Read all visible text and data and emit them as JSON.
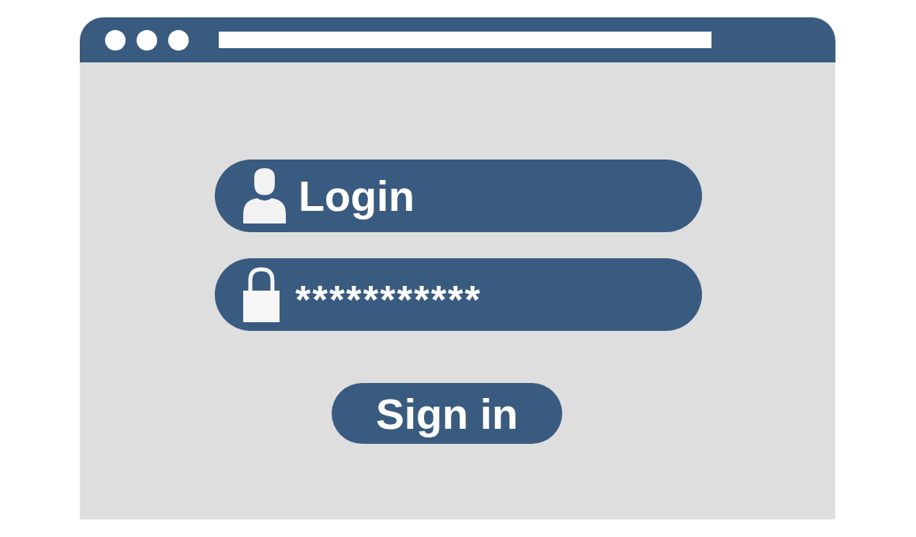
{
  "fields": [
    {
      "kind": "user",
      "value": "Login"
    },
    {
      "kind": "password",
      "value": "***********"
    }
  ],
  "button": {
    "label": "Sign in"
  }
}
